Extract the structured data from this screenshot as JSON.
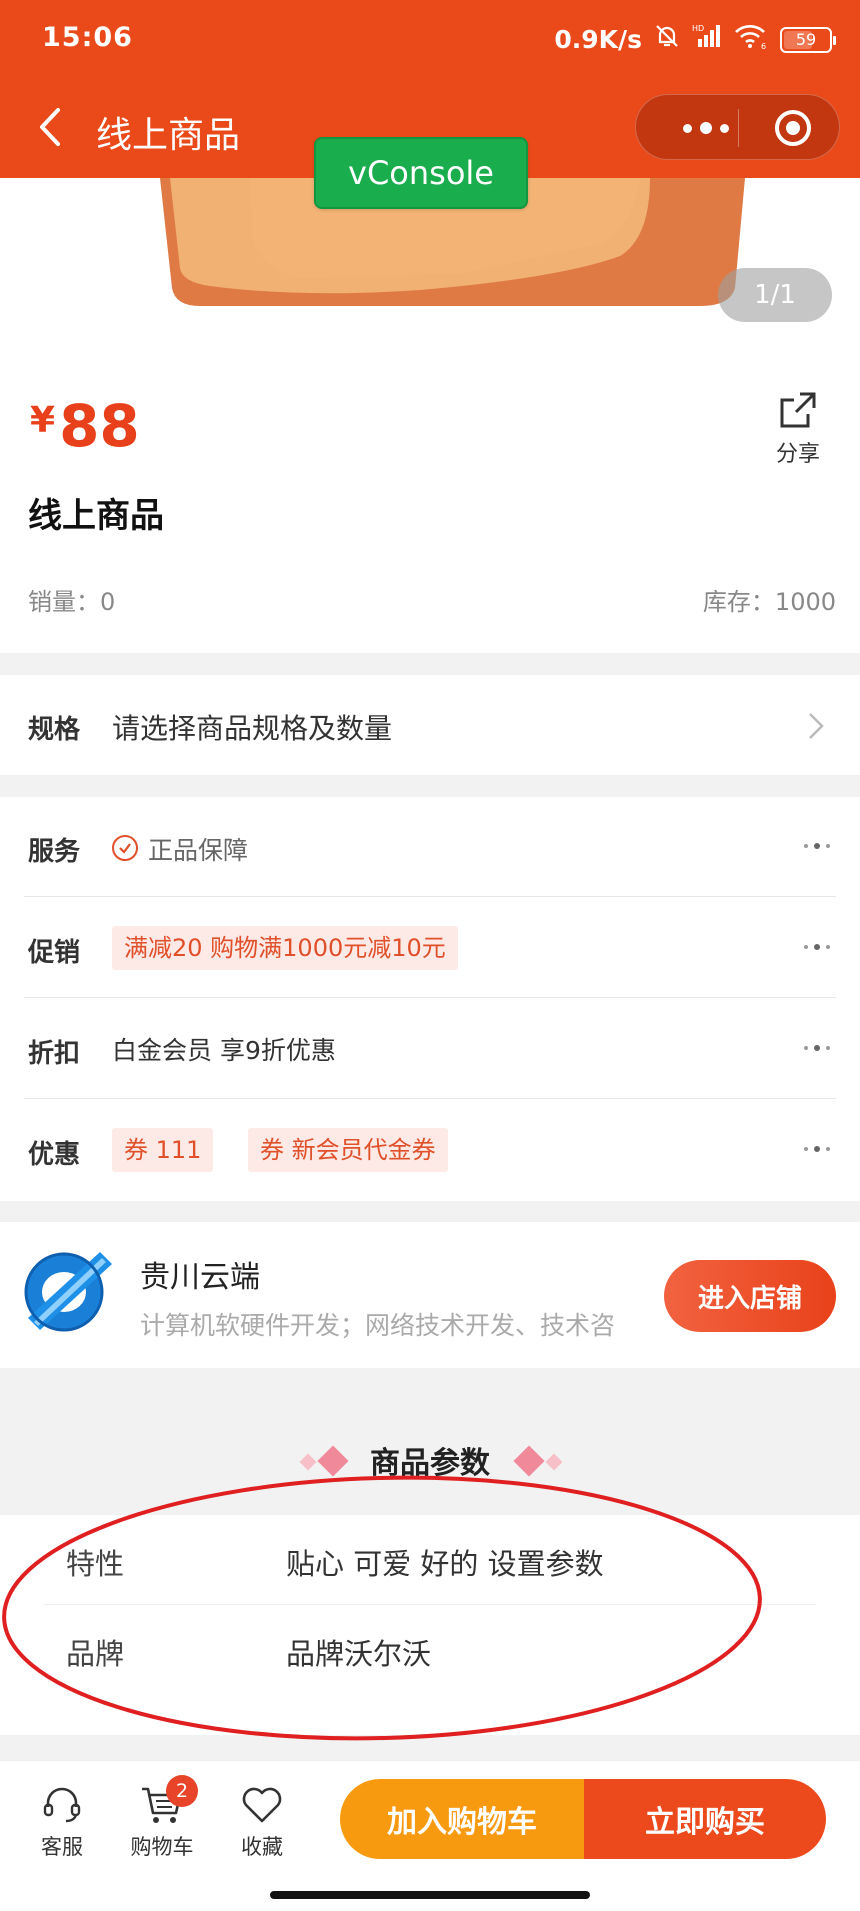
{
  "status_bar": {
    "time": "15:06",
    "network_speed": "0.9K/s",
    "signal_label": "HD",
    "wifi_label": "6",
    "battery": "59"
  },
  "nav": {
    "title": "线上商品",
    "vconsole_label": "vConsole"
  },
  "gallery": {
    "indicator": "1/1"
  },
  "product": {
    "currency": "¥",
    "price": "88",
    "name": "线上商品",
    "share_label": "分享",
    "sales": "销量：0",
    "stock": "库存：1000"
  },
  "spec": {
    "label": "规格",
    "placeholder": "请选择商品规格及数量"
  },
  "promotions": {
    "service": {
      "label": "服务",
      "text": "正品保障"
    },
    "sale": {
      "label": "促销",
      "tag": "满减20   购物满1000元减10元"
    },
    "discount": {
      "label": "折扣",
      "text": "白金会员 享9折优惠"
    },
    "coupon": {
      "label": "优惠",
      "tags": [
        "券   111",
        "券   新会员代金券"
      ]
    }
  },
  "shop": {
    "name": "贵川云端",
    "description": "计算机软硬件开发；网络技术开发、技术咨",
    "enter_label": "进入店铺"
  },
  "params": {
    "heading": "商品参数",
    "rows": [
      {
        "key": "特性",
        "value": "贴心 可爱 好的 设置参数"
      },
      {
        "key": "品牌",
        "value": "品牌沃尔沃"
      }
    ]
  },
  "bottom_bar": {
    "service_label": "客服",
    "cart_label": "购物车",
    "cart_count": "2",
    "favorite_label": "收藏",
    "add_to_cart": "加入购物车",
    "buy_now": "立即购买"
  },
  "colors": {
    "brand": "#ea4a1a",
    "price": "#e8401a",
    "cart_button": "#f89a10",
    "buy_button": "#ec4a1c",
    "annotation": "#e02020"
  }
}
